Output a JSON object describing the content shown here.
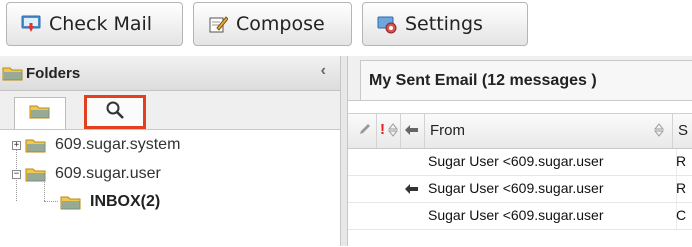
{
  "toolbar": {
    "check_mail": "Check Mail",
    "compose": "Compose",
    "settings": "Settings"
  },
  "folders": {
    "title": "Folders",
    "collapse_glyph": "‹",
    "tree": [
      {
        "label": "609.sugar.system",
        "expander": "+"
      },
      {
        "label": "609.sugar.user",
        "expander": "−"
      },
      {
        "label": "INBOX(2)",
        "expander": ""
      }
    ]
  },
  "mail": {
    "tab_label": "My Sent Email (12 messages )",
    "columns": {
      "flag": "!",
      "from": "From",
      "s": "S"
    },
    "rows": [
      {
        "from": "Sugar User <609.sugar.user",
        "s": "R",
        "replied": false
      },
      {
        "from": "Sugar User <609.sugar.user",
        "s": "R",
        "replied": true
      },
      {
        "from": "Sugar User <609.sugar.user",
        "s": "C",
        "replied": false
      }
    ]
  },
  "colors": {
    "highlight": "#e2401f",
    "folder_yellow": "#f2c94c",
    "folder_blue": "#4a8fd1"
  },
  "icons": [
    "check-mail-icon",
    "compose-icon",
    "settings-icon",
    "folder-icon",
    "search-icon",
    "pencil-icon",
    "sort-icon",
    "reply-icon"
  ]
}
